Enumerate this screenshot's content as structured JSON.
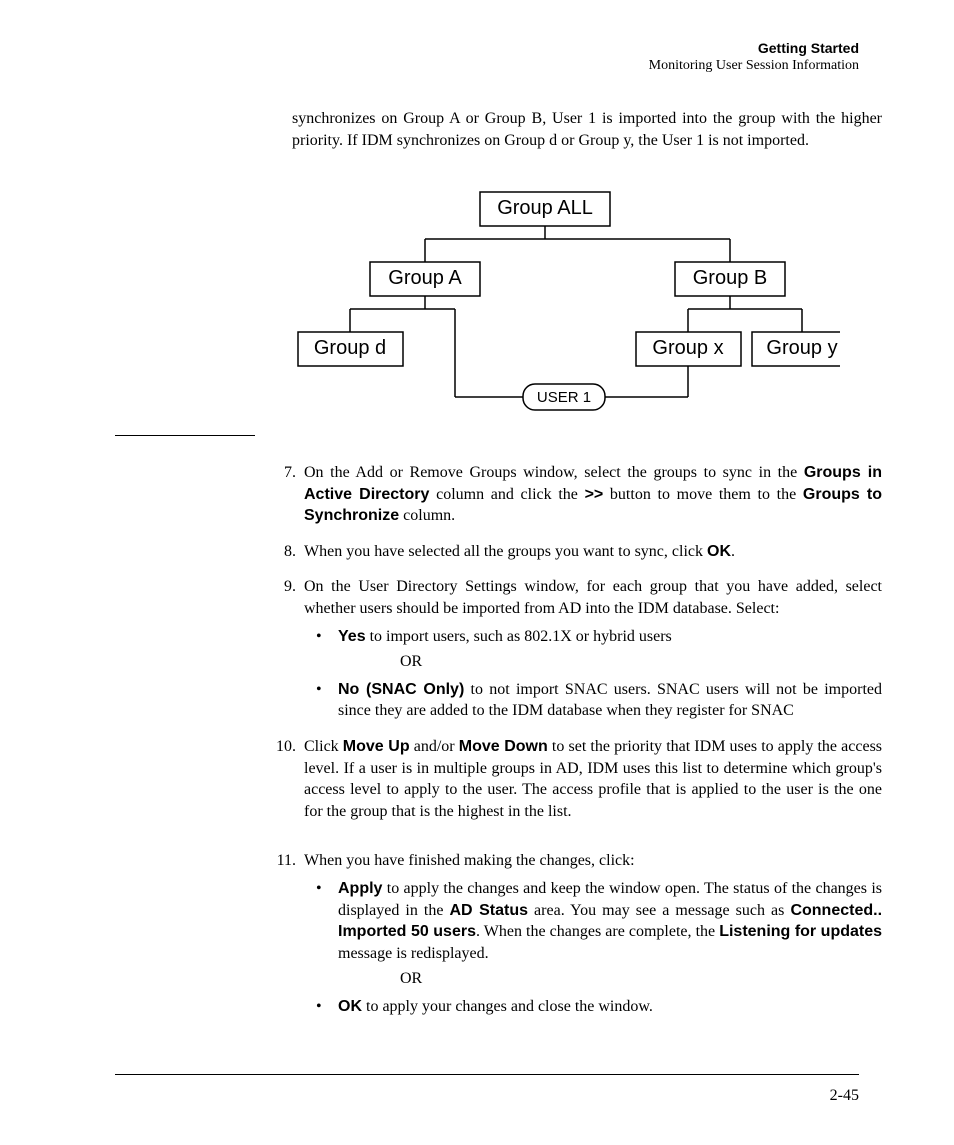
{
  "header": {
    "title": "Getting Started",
    "subtitle": "Monitoring User Session Information"
  },
  "intro_paragraph": "synchronizes on Group A or Group B, User 1 is imported into the group with the higher priority. If IDM synchronizes on Group d or Group y, the User 1 is not imported.",
  "diagram": {
    "nodes": {
      "all": "Group ALL",
      "a": "Group A",
      "b": "Group B",
      "d": "Group d",
      "x": "Group x",
      "y": "Group y",
      "user": "USER 1"
    }
  },
  "steps": {
    "s7": {
      "num": "7.",
      "p1": "On the Add or Remove Groups window, select the groups to sync in the ",
      "b1": "Groups in Active Directory",
      "p2": " column and click the ",
      "b2": ">>",
      "p3": " button to move them to the ",
      "b3": "Groups to Synchronize",
      "p4": " column."
    },
    "s8": {
      "num": "8.",
      "p1": "When you have selected all the groups you want to sync, click ",
      "b1": "OK",
      "p2": "."
    },
    "s9": {
      "num": "9.",
      "p1": "On the User Directory Settings window, for each group that you have added, select whether users should be imported from AD into the IDM database. Select:",
      "yes_label": "Yes",
      "yes_text": "  to import users, such as 802.1X or hybrid users",
      "or": "OR",
      "no_label": "No (SNAC Only)",
      "no_text": " to not import SNAC users. SNAC users will not be imported since they are added to the IDM database when they register for SNAC"
    },
    "s10": {
      "num": "10.",
      "p1": "Click ",
      "b1": "Move Up",
      "p2": " and/or ",
      "b2": "Move Down",
      "p3": " to set the priority that IDM uses to apply the access level. If a user is in multiple groups in AD, IDM uses this list to determine which group's access level to apply to the user. The access profile that is applied to the user is the one for the group that is the highest in the list."
    },
    "s11": {
      "num": "11.",
      "p1": "When you have finished making the changes, click:",
      "apply_label": "Apply",
      "apply_t1": " to apply the changes and keep the window open. The status of the changes is displayed in the ",
      "apply_b2": "AD Status",
      "apply_t2": " area. You may see a message such as ",
      "apply_b3": "Connected.. Imported 50 users",
      "apply_t3": ". When the changes are complete, the ",
      "apply_b4": "Listening for updates",
      "apply_t4": " message is redisplayed.",
      "or": "OR",
      "ok_label": "OK",
      "ok_text": " to apply your changes and close the window."
    }
  },
  "page_number": "2-45"
}
